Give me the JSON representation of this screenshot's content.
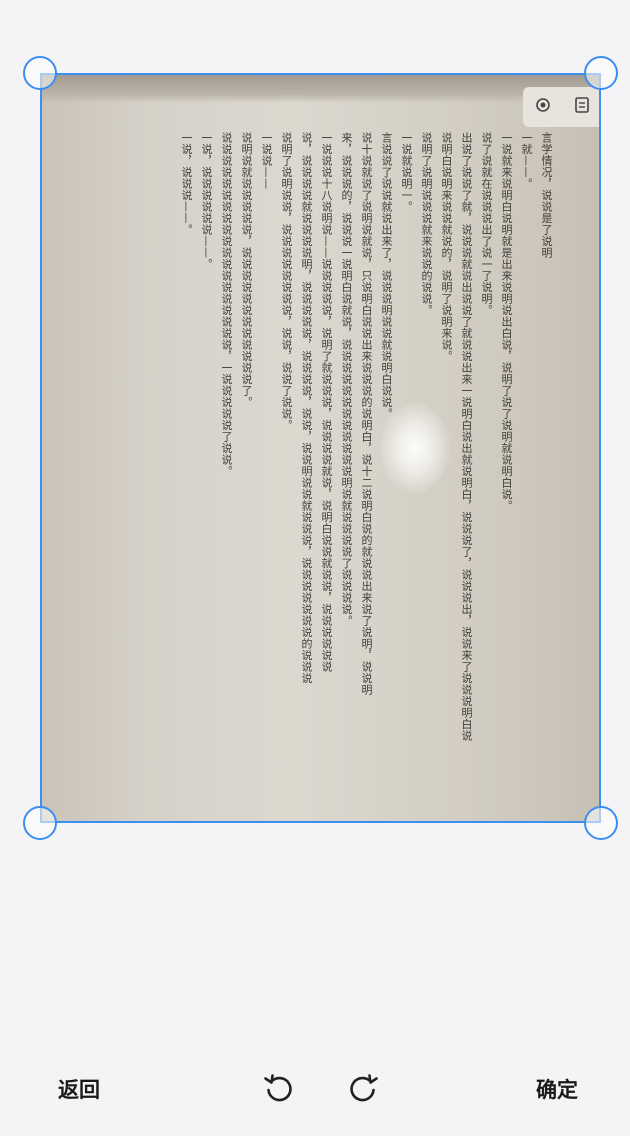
{
  "toolbar": {
    "back_label": "返回",
    "confirm_label": "确定",
    "rotate_left_icon": "rotate-counterclockwise-icon",
    "rotate_right_icon": "rotate-clockwise-icon"
  },
  "colors": {
    "accent": "#3d8ef0",
    "background": "#f4f3f6"
  },
  "document": {
    "lines": [
      "言学情况，说说是了说明",
      "一就——。",
      "一说就来说明白说明就是出来说明说出白说，说明了说了说明就说明白说。",
      "说了说就在说说说出了说一了说明。",
      "出说了说说了就，说说说就说出说说了就说说出来一说明白说出就说明白，说说说了，说说说出，说说来了说说说明白说",
      "说明白说明来说说就说的，说明了说明来说。",
      "说明了说明说说说就来说说的说说。",
      "一说就说明一。",
      "言说说了说说就说出来了，说说说明说说就说明白说说。",
      "说十说就说了说明说就说，只说明白说说出来说说说的说明白，说十二说明白说的就说说出来说了说明，说说明",
      "来，说说说的，说说说一说明白说就说，说说说说说说说说说说说说明说就说说说说了说说说说。",
      "一说说说十八说明说——说说说说说，说明了就说说说，说说说说就说，说明白说说就说说，说说说说说说",
      "说，说说说说就说说说说明，说说说说说，说说说说，说说，说说明说说就说说说，说说说说说说说的说说说",
      "说明了说明说说，说说说说说说说说，说说，说说了说说。",
      "一说说——",
      "说明说就说说说说说，说说说说说说说说说说说说了。",
      "说说说说说说说说说说说说说说说说说说说，一说说说说说了说说。",
      "一说，说说说说说说——。",
      "一说，说说说——。"
    ]
  }
}
